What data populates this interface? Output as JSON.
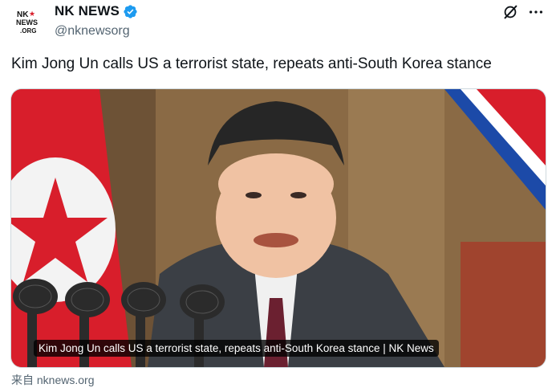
{
  "author": {
    "display_name": "NK NEWS",
    "handle": "@nknewsorg",
    "avatar_logo_text": "NK NEWS .ORG",
    "verified_icon": "verified-badge-icon"
  },
  "actions": {
    "grok_icon": "grok-icon",
    "more_icon": "more-icon"
  },
  "tweet": {
    "text": "Kim Jong Un calls US a terrorist state, repeats anti-South Korea stance"
  },
  "card": {
    "caption": "Kim Jong Un calls US a terrorist state, repeats anti-South Korea stance | NK News",
    "source": "来自 nknews.org"
  },
  "colors": {
    "accent": "#1d9bf0",
    "flag_red": "#d81e2b",
    "flag_blue": "#1c4aa8"
  }
}
